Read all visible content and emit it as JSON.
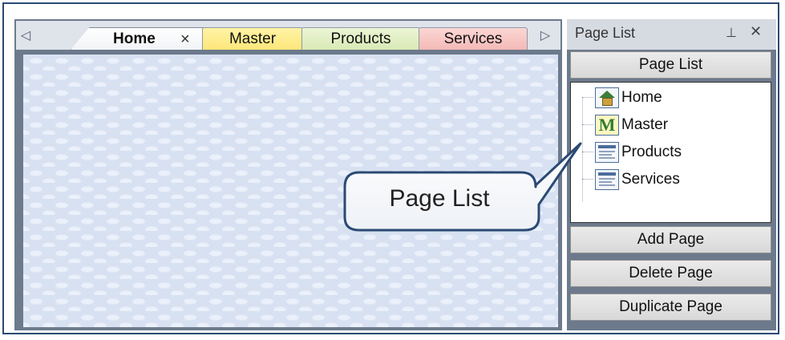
{
  "tabs": [
    {
      "label": "Home"
    },
    {
      "label": "Master"
    },
    {
      "label": "Products"
    },
    {
      "label": "Services"
    }
  ],
  "tab_close_glyph": "×",
  "scroll_left_glyph": "◁",
  "scroll_right_glyph": "▷",
  "panel": {
    "title": "Page List",
    "pin_glyph": "⊥",
    "close_glyph": "✕",
    "page_list_button": "Page List",
    "tree_items": [
      {
        "label": "Home",
        "icon": "home-page-icon"
      },
      {
        "label": "Master",
        "icon": "master-page-icon"
      },
      {
        "label": "Products",
        "icon": "page-icon"
      },
      {
        "label": "Services",
        "icon": "page-icon"
      }
    ],
    "add_button": "Add Page",
    "delete_button": "Delete Page",
    "duplicate_button": "Duplicate Page"
  },
  "callout": {
    "text": "Page List"
  },
  "colors": {
    "frame": "#2b4a74",
    "master_tab": "#fde67a",
    "products_tab": "#d8eab5",
    "services_tab": "#f4b9b6",
    "canvas": "#d7e1f1"
  }
}
